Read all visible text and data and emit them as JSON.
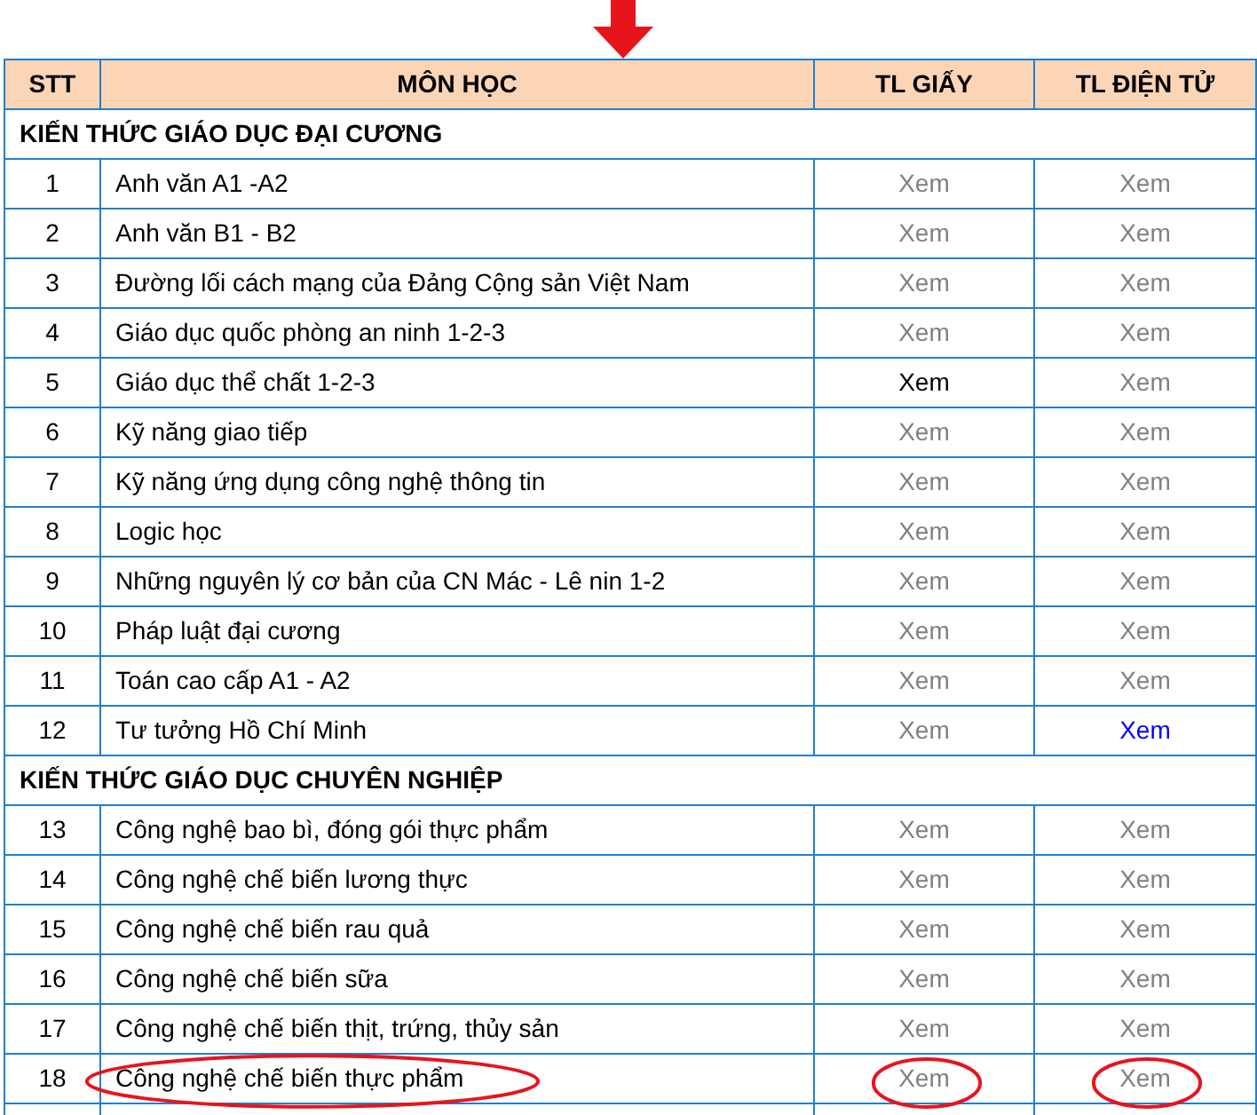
{
  "table": {
    "columns": [
      "STT",
      "MÔN HỌC",
      "TL GIẤY",
      "TL ĐIỆN TỬ"
    ],
    "sections": [
      {
        "title": "KIẾN THỨC GIÁO DỤC ĐẠI CƯƠNG",
        "rows": [
          {
            "stt": "1",
            "name": "Anh văn A1 -A2",
            "circled": false,
            "paper": {
              "text": "Xem",
              "color": "#808080",
              "circled": false
            },
            "digital": {
              "text": "Xem",
              "color": "#808080",
              "circled": false
            }
          },
          {
            "stt": "2",
            "name": "Anh văn B1 - B2",
            "circled": false,
            "paper": {
              "text": "Xem",
              "color": "#808080",
              "circled": false
            },
            "digital": {
              "text": "Xem",
              "color": "#808080",
              "circled": false
            }
          },
          {
            "stt": "3",
            "name": "Đường lối cách mạng của Đảng Cộng sản Việt Nam",
            "circled": false,
            "paper": {
              "text": "Xem",
              "color": "#808080",
              "circled": false
            },
            "digital": {
              "text": "Xem",
              "color": "#808080",
              "circled": false
            }
          },
          {
            "stt": "4",
            "name": "Giáo dục quốc phòng an ninh 1-2-3",
            "circled": false,
            "paper": {
              "text": "Xem",
              "color": "#808080",
              "circled": false
            },
            "digital": {
              "text": "Xem",
              "color": "#808080",
              "circled": false
            }
          },
          {
            "stt": "5",
            "name": "Giáo dục thể chất 1-2-3",
            "circled": false,
            "paper": {
              "text": "Xem",
              "color": "#000000",
              "circled": false
            },
            "digital": {
              "text": "Xem",
              "color": "#808080",
              "circled": false
            }
          },
          {
            "stt": "6",
            "name": "Kỹ năng giao tiếp",
            "circled": false,
            "paper": {
              "text": "Xem",
              "color": "#808080",
              "circled": false
            },
            "digital": {
              "text": "Xem",
              "color": "#808080",
              "circled": false
            }
          },
          {
            "stt": "7",
            "name": "Kỹ năng ứng dụng công nghệ thông tin",
            "circled": false,
            "paper": {
              "text": "Xem",
              "color": "#808080",
              "circled": false
            },
            "digital": {
              "text": "Xem",
              "color": "#808080",
              "circled": false
            }
          },
          {
            "stt": "8",
            "name": "Logic học",
            "circled": false,
            "paper": {
              "text": "Xem",
              "color": "#808080",
              "circled": false
            },
            "digital": {
              "text": "Xem",
              "color": "#808080",
              "circled": false
            }
          },
          {
            "stt": "9",
            "name": "Những nguyên lý cơ bản của CN Mác - Lê nin 1-2",
            "circled": false,
            "paper": {
              "text": "Xem",
              "color": "#808080",
              "circled": false
            },
            "digital": {
              "text": "Xem",
              "color": "#808080",
              "circled": false
            }
          },
          {
            "stt": "10",
            "name": "Pháp luật đại cương",
            "circled": false,
            "paper": {
              "text": "Xem",
              "color": "#808080",
              "circled": false
            },
            "digital": {
              "text": "Xem",
              "color": "#808080",
              "circled": false
            }
          },
          {
            "stt": "11",
            "name": "Toán cao cấp A1 - A2",
            "circled": false,
            "paper": {
              "text": "Xem",
              "color": "#808080",
              "circled": false
            },
            "digital": {
              "text": "Xem",
              "color": "#808080",
              "circled": false
            }
          },
          {
            "stt": "12",
            "name": "Tư tưởng Hồ Chí Minh",
            "circled": false,
            "paper": {
              "text": "Xem",
              "color": "#808080",
              "circled": false
            },
            "digital": {
              "text": "Xem",
              "color": "#0000ff",
              "circled": false
            }
          }
        ]
      },
      {
        "title": "KIẾN THỨC GIÁO DỤC CHUYÊN NGHIỆP",
        "rows": [
          {
            "stt": "13",
            "name": "Công nghệ bao bì, đóng gói thực phẩm",
            "circled": false,
            "paper": {
              "text": "Xem",
              "color": "#808080",
              "circled": false
            },
            "digital": {
              "text": "Xem",
              "color": "#808080",
              "circled": false
            }
          },
          {
            "stt": "14",
            "name": "Công nghệ chế biến lương thực",
            "circled": false,
            "paper": {
              "text": "Xem",
              "color": "#808080",
              "circled": false
            },
            "digital": {
              "text": "Xem",
              "color": "#808080",
              "circled": false
            }
          },
          {
            "stt": "15",
            "name": "Công nghệ chế biến rau quả",
            "circled": false,
            "paper": {
              "text": "Xem",
              "color": "#808080",
              "circled": false
            },
            "digital": {
              "text": "Xem",
              "color": "#808080",
              "circled": false
            }
          },
          {
            "stt": "16",
            "name": "Công nghệ chế biến sữa",
            "circled": false,
            "paper": {
              "text": "Xem",
              "color": "#808080",
              "circled": false
            },
            "digital": {
              "text": "Xem",
              "color": "#808080",
              "circled": false
            }
          },
          {
            "stt": "17",
            "name": "Công nghệ chế biến thịt, trứng, thủy sản",
            "circled": false,
            "paper": {
              "text": "Xem",
              "color": "#808080",
              "circled": false
            },
            "digital": {
              "text": "Xem",
              "color": "#808080",
              "circled": false
            }
          },
          {
            "stt": "18",
            "name": "Công nghệ chế biến thực phẩm",
            "circled": true,
            "paper": {
              "text": "Xem",
              "color": "#808080",
              "circled": true
            },
            "digital": {
              "text": "Xem",
              "color": "#808080",
              "circled": true
            }
          }
        ]
      }
    ]
  }
}
